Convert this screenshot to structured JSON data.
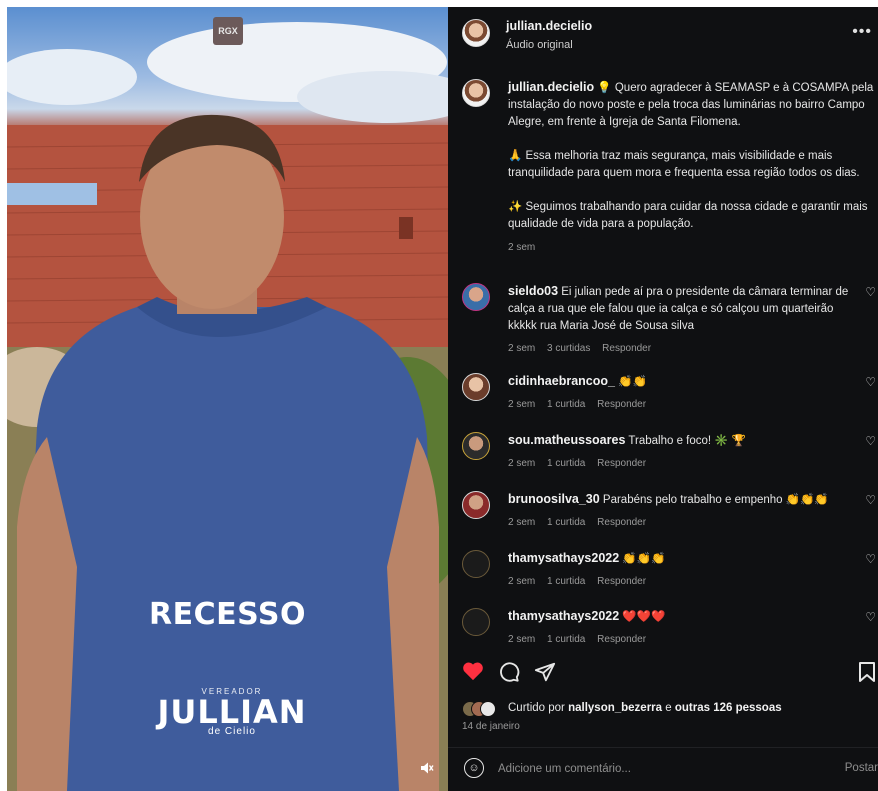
{
  "media": {
    "badge": "RGX",
    "overlay_title": "RECESSO",
    "brand_small": "VEREADOR",
    "brand_name": "JULLIAN",
    "brand_sub": "de Cielio",
    "mute_icon": "muted-speaker-icon"
  },
  "header": {
    "username": "jullian.decielio",
    "audio": "Áudio original",
    "more": "•••"
  },
  "caption": {
    "username": "jullian.decielio",
    "p1": "💡 Quero agradecer à SEAMASP e à COSAMPA pela instalação do novo poste e pela troca das luminárias no bairro Campo Alegre, em frente à Igreja de Santa Filomena.",
    "p2": "🙏 Essa melhoria traz mais segurança, mais visibilidade e mais tranquilidade para quem mora e frequenta essa região todos os dias.",
    "p3": "✨ Seguimos trabalhando para cuidar da nossa cidade e garantir mais qualidade de vida para a população.",
    "time": "2 sem"
  },
  "comments": [
    {
      "user": "sieldo03",
      "text": "Ei julian pede aí pra o presidente da câmara terminar de calça a rua que ele falou que ia calça e só calçou um quarteirão kkkkk rua Maria José de Sousa silva",
      "time": "2 sem",
      "likes": "3 curtidas",
      "reply": "Responder"
    },
    {
      "user": "cidinhaebrancoo_",
      "text": "👏👏",
      "time": "2 sem",
      "likes": "1 curtida",
      "reply": "Responder"
    },
    {
      "user": "sou.matheussoares",
      "text": "Trabalho e foco! ✳️ 🏆",
      "time": "2 sem",
      "likes": "1 curtida",
      "reply": "Responder"
    },
    {
      "user": "brunoosilva_30",
      "text": "Parabéns pelo trabalho e empenho 👏👏👏",
      "time": "2 sem",
      "likes": "1 curtida",
      "reply": "Responder"
    },
    {
      "user": "thamysathays2022",
      "text": "👏👏👏",
      "time": "2 sem",
      "likes": "1 curtida",
      "reply": "Responder"
    },
    {
      "user": "thamysathays2022",
      "text": "❤️❤️❤️",
      "time": "2 sem",
      "likes": "1 curtida",
      "reply": "Responder"
    }
  ],
  "actions": {
    "like_icon": "heart-filled-icon",
    "comment_icon": "speech-bubble-icon",
    "share_icon": "paper-plane-icon",
    "save_icon": "bookmark-icon",
    "like_color": "#ff3040"
  },
  "likes": {
    "prefix": "Curtido por ",
    "user": "nallyson_bezerra",
    "middle": " e ",
    "others": "outras 126 pessoas"
  },
  "date": "14 de janeiro",
  "comment_box": {
    "placeholder": "Adicione um comentário...",
    "post_label": "Postar"
  }
}
